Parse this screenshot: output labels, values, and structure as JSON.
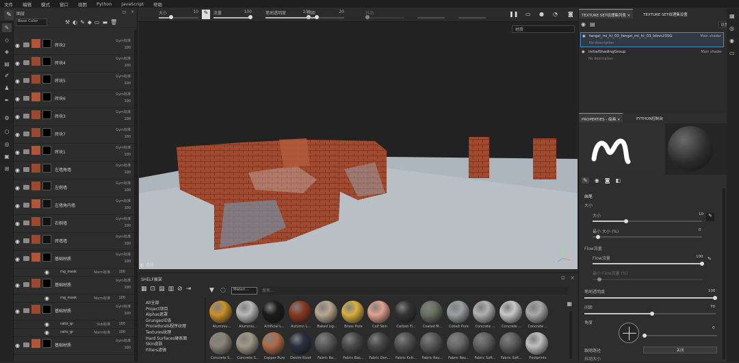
{
  "menu": [
    "文件",
    "编辑",
    "模式",
    "窗口",
    "视图",
    "Python",
    "JavaScript",
    "帮助"
  ],
  "toolbar": {
    "size": {
      "label": "大小",
      "value": "10"
    },
    "flow": {
      "label": "流量",
      "value": "100"
    },
    "stroke_opacity": {
      "label": "笔刷透明度",
      "value": "100"
    },
    "spacing": {
      "label": "间距",
      "value": "20"
    },
    "jitter": {
      "label": "抖动"
    }
  },
  "layers": {
    "header": "图层",
    "channel": "Base Color",
    "rows": [
      {
        "name": "砖块2",
        "blend": "Gym标准",
        "opacity": "100"
      },
      {
        "name": "砖块4",
        "blend": "Gym标准",
        "opacity": "100"
      },
      {
        "name": "砖块5",
        "blend": "Gym标准",
        "opacity": "100"
      },
      {
        "name": "砖块6",
        "blend": "Gym标准",
        "opacity": "100"
      },
      {
        "name": "砖块3",
        "blend": "Gym标准",
        "opacity": "100"
      },
      {
        "name": "砖块7",
        "blend": "Gym标准",
        "opacity": "100"
      },
      {
        "name": "砖块1",
        "blend": "Gym标准",
        "opacity": "100"
      },
      {
        "name": "左墙角墙",
        "blend": "Gym标准",
        "opacity": "100"
      },
      {
        "name": "左侧墙",
        "blend": "Gym标准",
        "opacity": "100"
      },
      {
        "name": "左墙角内墙",
        "blend": "Gym标准",
        "opacity": "100"
      },
      {
        "name": "右侧墙",
        "blend": "Gym标准",
        "opacity": "100"
      },
      {
        "name": "砖墙墙",
        "blend": "Gym标准",
        "opacity": "100"
      },
      {
        "name": "基础材质",
        "blend": "Gym标准",
        "opacity": "100"
      },
      {
        "name": "基础材质",
        "blend": "Gym标准",
        "opacity": "100"
      },
      {
        "name": "基础材质",
        "blend": "Gym标准",
        "opacity": "100"
      },
      {
        "name": "基础材质",
        "blend": "Gym标准",
        "opacity": "100"
      }
    ],
    "masks": [
      {
        "name": "mg_mask",
        "blend": "Norm标准",
        "opacity": "100"
      },
      {
        "name": "mg_mask",
        "blend": "Norm标准",
        "opacity": "100"
      },
      {
        "name": "ratio_gr",
        "blend": "Sub标准",
        "opacity": "100"
      },
      {
        "name": "ratio_gr",
        "blend": "Norm标准",
        "opacity": "100"
      }
    ]
  },
  "viewport": {
    "mode": "材质",
    "label": "透视"
  },
  "shelf": {
    "title": "SHELF展架",
    "search_placeholder": "搜索...",
    "filter": "Materi...",
    "categories": [
      "All全部",
      "Project项目",
      "Alphas遮罩",
      "Grunges垃圾",
      "Procedurals程序纹理",
      "Textures纹理",
      "Hard Surfaces硬表面",
      "Skin皮肤",
      "Filters滤镜"
    ],
    "materials_row1": [
      "Aluminiu...",
      "Aluminiu...",
      "Artificial L...",
      "Autumn L...",
      "Baked Lig...",
      "Brass Pure",
      "Calf Skin",
      "Carbon Fi...",
      "Coated M...",
      "Cobalt Pure",
      "Concrete ...",
      "Concrete ...",
      "Concrete ..."
    ],
    "materials_row2": [
      "Concrete S...",
      "Concrete S...",
      "Copper Pure",
      "Denim Rivet",
      "Fabric Ba...",
      "Fabric Bas...",
      "Fabric Den...",
      "Fabric Knit...",
      "Fabric Rou...",
      "Fabric Rou...",
      "Fabric Soft...",
      "Fabric Soft...",
      "Footprints"
    ]
  },
  "texture_sets": {
    "tab1": "TEXTURE SET纹理集列表",
    "tab2": "TEXTURE SET纹理集设置",
    "settings": "设置",
    "items": [
      {
        "name": "fangzi_mi_hi_03_fangzi_mi_hi_03_blinn23SG",
        "shader": "Main shader",
        "desc": "No description"
      },
      {
        "name": "initialShadingGroup",
        "shader": "Main shader",
        "desc": "No description"
      }
    ]
  },
  "properties": {
    "tab1": "PROPERTIES - 绘画",
    "tab2": "PYTHON控制台",
    "section": "画笔",
    "size_group": "大小",
    "size_label": "大小",
    "size_value": "10",
    "min_size_label": "最小 大小 (%)",
    "min_size_value": "0",
    "flow_group": "Flow流量",
    "flow_label": "Flow流量",
    "flow_value": "100",
    "min_flow_label": "最小 Flow流量 (%)",
    "opacity_label": "笔刷透明度",
    "opacity_value": "100",
    "spacing_label": "间距",
    "spacing_value": "70",
    "angle_label": "角度",
    "angle_value": "0",
    "follow_path_label": "跟随路径",
    "follow_path_value": "关闭",
    "jitter_size_label": "抖动大小"
  }
}
